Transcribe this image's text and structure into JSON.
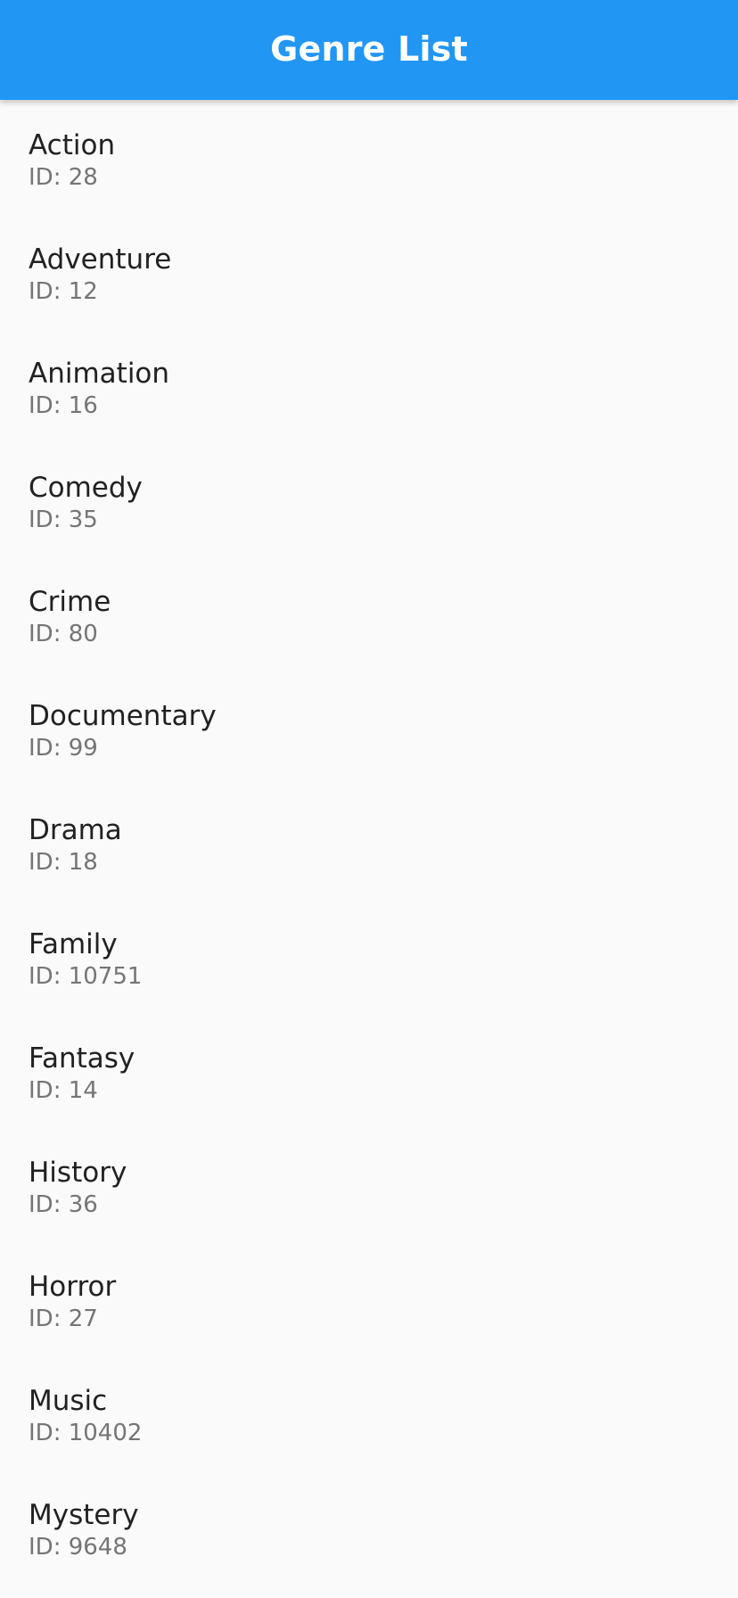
{
  "appbar": {
    "title": "Genre List",
    "background_color": "#2196f3"
  },
  "genres": [
    {
      "name": "Action",
      "id_label": "ID: 28"
    },
    {
      "name": "Adventure",
      "id_label": "ID: 12"
    },
    {
      "name": "Animation",
      "id_label": "ID: 16"
    },
    {
      "name": "Comedy",
      "id_label": "ID: 35"
    },
    {
      "name": "Crime",
      "id_label": "ID: 80"
    },
    {
      "name": "Documentary",
      "id_label": "ID: 99"
    },
    {
      "name": "Drama",
      "id_label": "ID: 18"
    },
    {
      "name": "Family",
      "id_label": "ID: 10751"
    },
    {
      "name": "Fantasy",
      "id_label": "ID: 14"
    },
    {
      "name": "History",
      "id_label": "ID: 36"
    },
    {
      "name": "Horror",
      "id_label": "ID: 27"
    },
    {
      "name": "Music",
      "id_label": "ID: 10402"
    },
    {
      "name": "Mystery",
      "id_label": "ID: 9648"
    }
  ]
}
